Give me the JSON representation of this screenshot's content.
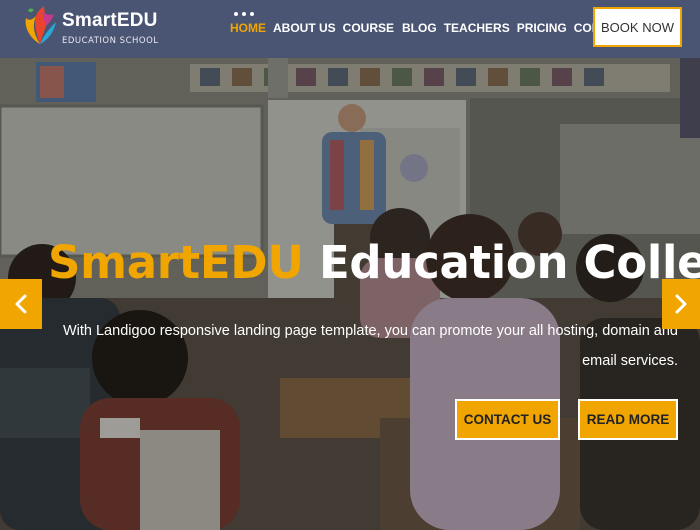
{
  "brand": {
    "name": "SmartEDU",
    "tagline": "EDUCATION SCHOOL"
  },
  "nav": {
    "items": [
      {
        "label": "HOME",
        "active": true
      },
      {
        "label": "ABOUT US",
        "active": false
      },
      {
        "label": "COURSE",
        "active": false
      },
      {
        "label": "BLOG",
        "active": false
      },
      {
        "label": "TEACHERS",
        "active": false
      },
      {
        "label": "PRICING",
        "active": false
      },
      {
        "label": "CONTACT",
        "active": false
      }
    ],
    "book_label": "BOOK NOW"
  },
  "hero": {
    "title_brand": "SmartEDU",
    "title_rest": " Education College",
    "description": "With Landigoo responsive landing page template, you can promote your all hosting, domain and email services.",
    "contact_label": "CONTACT US",
    "read_label": "READ MORE"
  },
  "icons": {
    "prev": "chevron-left-icon",
    "next": "chevron-right-icon",
    "logo": "flame-book-logo-icon",
    "menu_dots": "dots-icon"
  },
  "colors": {
    "header_bg": "#4a5573",
    "accent": "#f0a500",
    "text": "#ffffff"
  }
}
